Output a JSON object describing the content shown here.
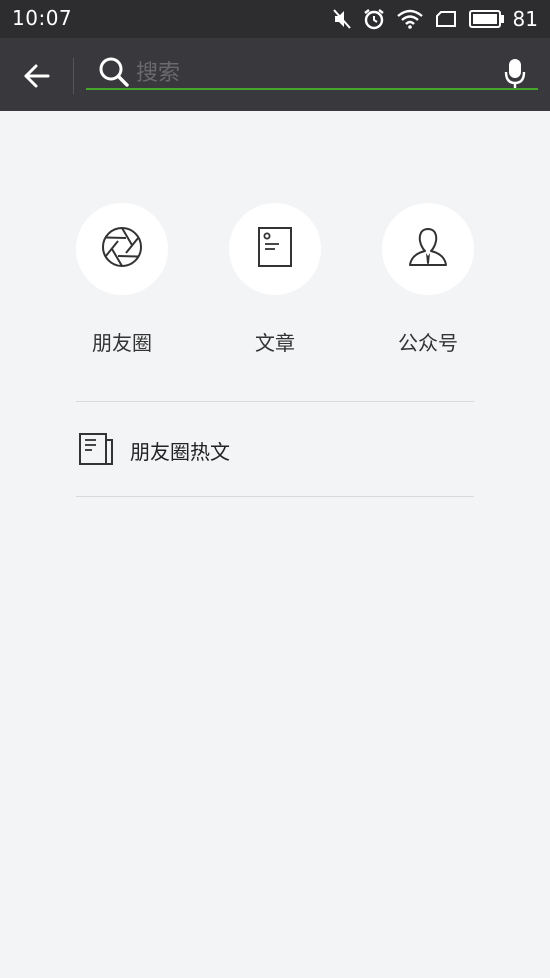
{
  "status_bar": {
    "time": "10:07",
    "battery_percent": "81",
    "icons": [
      "mute-icon",
      "alarm-icon",
      "wifi-icon",
      "sim-icon",
      "battery-icon"
    ]
  },
  "search": {
    "placeholder": "搜索",
    "value": "",
    "accent_color": "#46a52a"
  },
  "categories": [
    {
      "label": "朋友圈",
      "icon": "aperture-icon"
    },
    {
      "label": "文章",
      "icon": "article-icon"
    },
    {
      "label": "公众号",
      "icon": "official-account-icon"
    }
  ],
  "hot_articles": {
    "label": "朋友圈热文",
    "icon": "newspaper-icon"
  }
}
